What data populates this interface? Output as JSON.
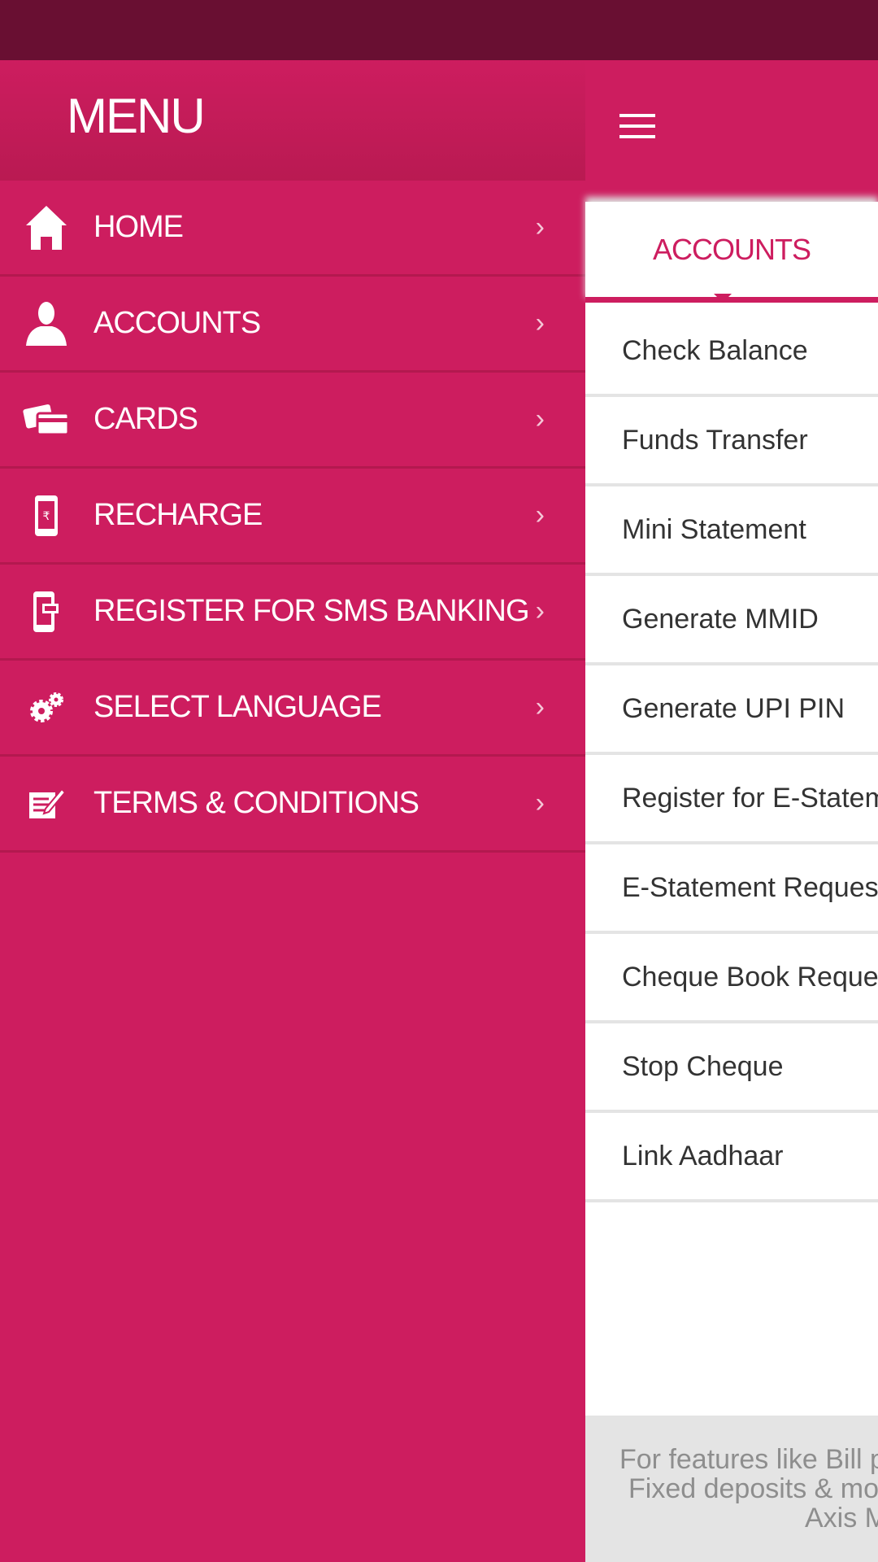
{
  "drawer": {
    "title": "MENU",
    "items": [
      {
        "label": "HOME",
        "icon": "home-icon"
      },
      {
        "label": "ACCOUNTS",
        "icon": "user-icon"
      },
      {
        "label": "CARDS",
        "icon": "cards-icon"
      },
      {
        "label": "RECHARGE",
        "icon": "mobile-rupee-icon"
      },
      {
        "label": "REGISTER FOR SMS BANKING",
        "icon": "mobile-message-icon"
      },
      {
        "label": "SELECT LANGUAGE",
        "icon": "gears-icon"
      },
      {
        "label": "TERMS & CONDITIONS",
        "icon": "document-edit-icon"
      }
    ],
    "chevron": "›"
  },
  "main": {
    "tab": "ACCOUNTS",
    "items": [
      "Check Balance",
      "Funds Transfer",
      "Mini Statement",
      "Generate MMID",
      "Generate UPI PIN",
      "Register for E-Statement",
      "E-Statement Request",
      "Cheque Book Request",
      "Stop Cheque",
      "Link Aadhaar"
    ],
    "footer": [
      "For features like Bill payments,",
      "Fixed deposits & more, download",
      "Axis Mobile"
    ]
  },
  "colors": {
    "brand": "#cd1d5f",
    "status_bar": "#690f32",
    "footer_bg": "#e4e4e4"
  }
}
